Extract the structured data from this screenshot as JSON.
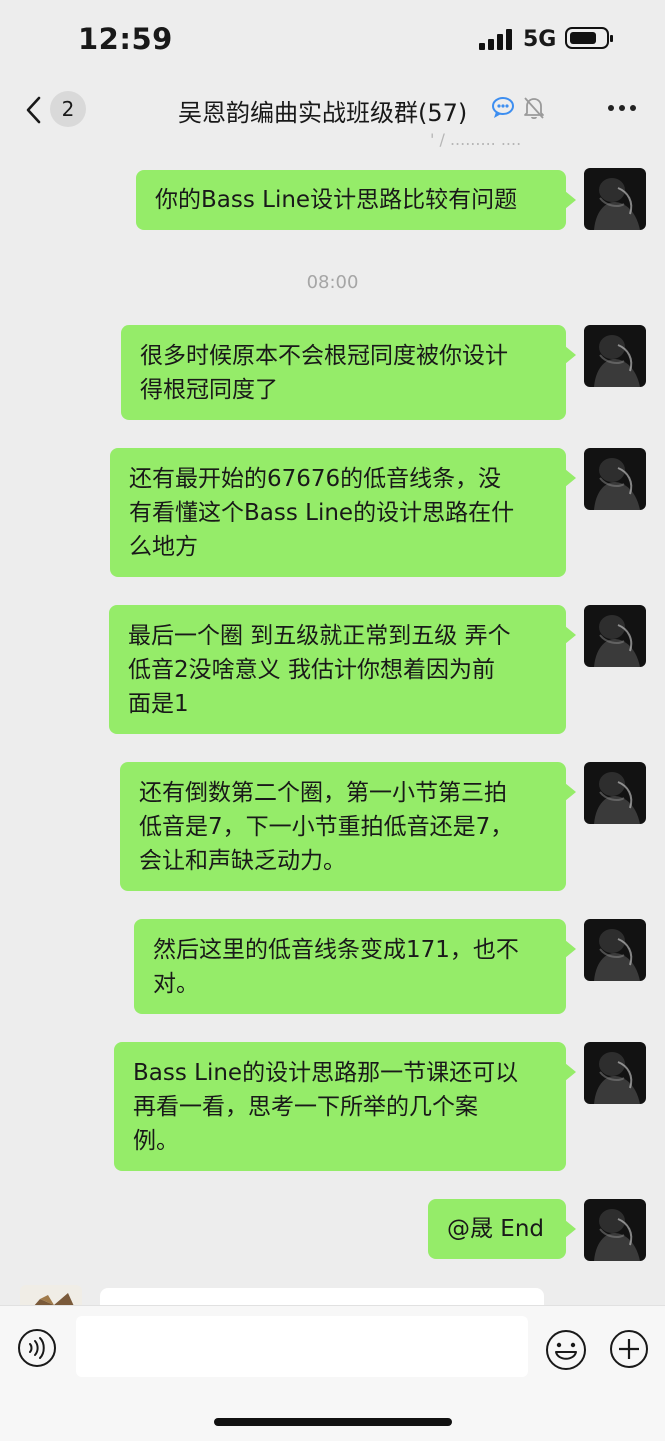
{
  "status_bar": {
    "time": "12:59",
    "network": "5G"
  },
  "header": {
    "back_badge": "2",
    "title": "吴恩韵编曲实战班级群(57)",
    "icons": [
      "chevron-left-icon",
      "chat-bubble-icon",
      "mute-bell-icon",
      "more-icon"
    ]
  },
  "ghost_text": "' / ......... ....",
  "timestamp": "08:00",
  "messages": [
    {
      "text": "你的Bass Line设计思路比较有问题"
    },
    {
      "text": "很多时候原本不会根冠同度被你设计\n得根冠同度了"
    },
    {
      "text": "还有最开始的67676的低音线条，没\n有看懂这个Bass Line的设计思路在什\n么地方"
    },
    {
      "text": "最后一个圈 到五级就正常到五级 弄个\n低音2没啥意义 我估计你想着因为前\n面是1"
    },
    {
      "text": "还有倒数第二个圈，第一小节第三拍\n低音是7，下一小节重拍低音还是7，\n会让和声缺乏动力。"
    },
    {
      "text": "然后这里的低音线条变成171，也不\n对。"
    },
    {
      "text": "Bass Line的设计思路那一节课还可以\n再看一看，思考一下所举的几个案\n例。"
    },
    {
      "text": "@晟 End"
    }
  ],
  "input_bar": {
    "icons": [
      "voice-icon",
      "emoji-icon",
      "plus-icon"
    ],
    "input_value": ""
  },
  "colors": {
    "bubble": "#95ec69",
    "background": "#ededed",
    "input_bar": "#f7f7f7"
  }
}
